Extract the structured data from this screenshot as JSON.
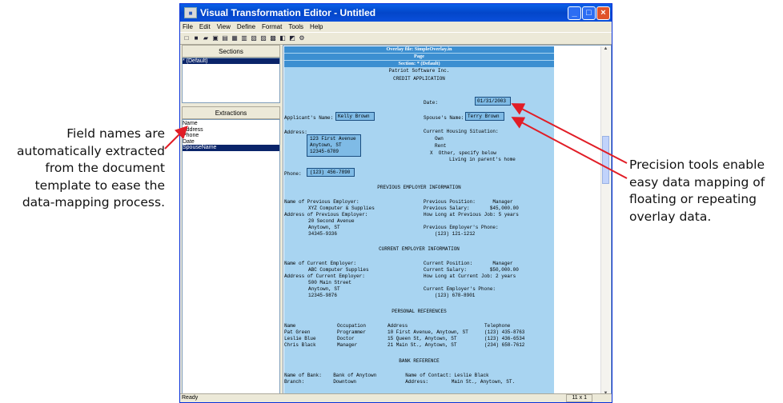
{
  "callouts": {
    "left": [
      "Field names are",
      "automatically extracted",
      "from the document",
      "template to ease the",
      "data-mapping process."
    ],
    "right": [
      "Precision tools enable",
      "easy data mapping of",
      "floating or repeating",
      "overlay data."
    ]
  },
  "window": {
    "title": "Visual Transformation Editor - Untitled",
    "menu": [
      "File",
      "Edit",
      "View",
      "Define",
      "Format",
      "Tools",
      "Help"
    ],
    "controls": {
      "minimize": "_",
      "maximize": "□",
      "close": "×"
    }
  },
  "sections_panel": {
    "header": "Sections",
    "items": [
      "* (Default)"
    ]
  },
  "extractions_panel": {
    "header": "Extractions",
    "items": [
      "Name",
      "Address",
      "Phone",
      "Date",
      "SpouseName"
    ],
    "selected": "SpouseName"
  },
  "document": {
    "bands": [
      "Overlay file: SimpleOverlay.in",
      "Page",
      "Section: * (Default)"
    ],
    "company": "Patriot Software Inc.",
    "form_title": "CREDIT APPLICATION",
    "date_label": "Date:",
    "date_value": "01/31/2003",
    "applicant_label": "Applicant's Name:",
    "applicant_value": "Kelly Brown",
    "spouse_label": "Spouse's Name:",
    "spouse_value": "Terry Brown",
    "address_label": "Address:",
    "address_lines": [
      "123 First Avenue",
      "Anytown, ST",
      "12345-6789"
    ],
    "housing_label": "Current Housing Situation:",
    "housing_options": [
      "Own",
      "Rent",
      "X  Other, specify below"
    ],
    "housing_other": "Living in parent's home",
    "phone_label": "Phone:",
    "phone_value": "(123) 456-7890",
    "prev_header": "PREVIOUS EMPLOYER INFORMATION",
    "prev": {
      "employer_label": "Name of Previous Employer:",
      "employer": "XYZ Computer & Supplies",
      "address_label": "Address of Previous Employer:",
      "address": [
        "20 Second Avenue",
        "Anytown, ST",
        "34345-9336"
      ],
      "position": "Previous Position:      Manager",
      "salary": "Previous Salary:       $45,000.00",
      "how_long": "How Long at Previous Job: 5 years",
      "phone_label": "Previous Employer's Phone:",
      "phone": "(123) 121-1212"
    },
    "curr_header": "CURRENT EMPLOYER INFORMATION",
    "curr": {
      "employer_label": "Name of Current Employer:",
      "employer": "ABC Computer Supplies",
      "address_label": "Address of Current Employer:",
      "address": [
        "500 Main Street",
        "Anytown, ST",
        "12345-9876"
      ],
      "position": "Current Position:       Manager",
      "salary": "Current Salary:        $50,000.00",
      "how_long": "How Long at Current Job: 2 years",
      "phone_label": "Current Employer's Phone:",
      "phone": "(123) 678-8901"
    },
    "refs_header": "PERSONAL REFERENCES",
    "refs_columns": [
      "Name",
      "Occupation",
      "Address",
      "Telephone"
    ],
    "refs": [
      [
        "Pat Green",
        "Programmer",
        "10 First Avenue, Anytown, ST",
        "(123) 435-8763"
      ],
      [
        "Leslie Blue",
        "Doctor",
        "15 Queen St, Anytown, ST",
        "(123) 436-6534"
      ],
      [
        "Chris Black",
        "Manager",
        "21 Main St., Anytown, ST",
        "(234) 658-7612"
      ]
    ],
    "bank_header": "BANK REFERENCE",
    "bank_line1": "Name of Bank:    Bank of Anytown          Name of Contact: Leslie Black",
    "bank_line2": "Branch:          Downtown                 Address:        Main St., Anytown, ST."
  },
  "status": {
    "text": "Ready",
    "position": "11 x 1"
  }
}
